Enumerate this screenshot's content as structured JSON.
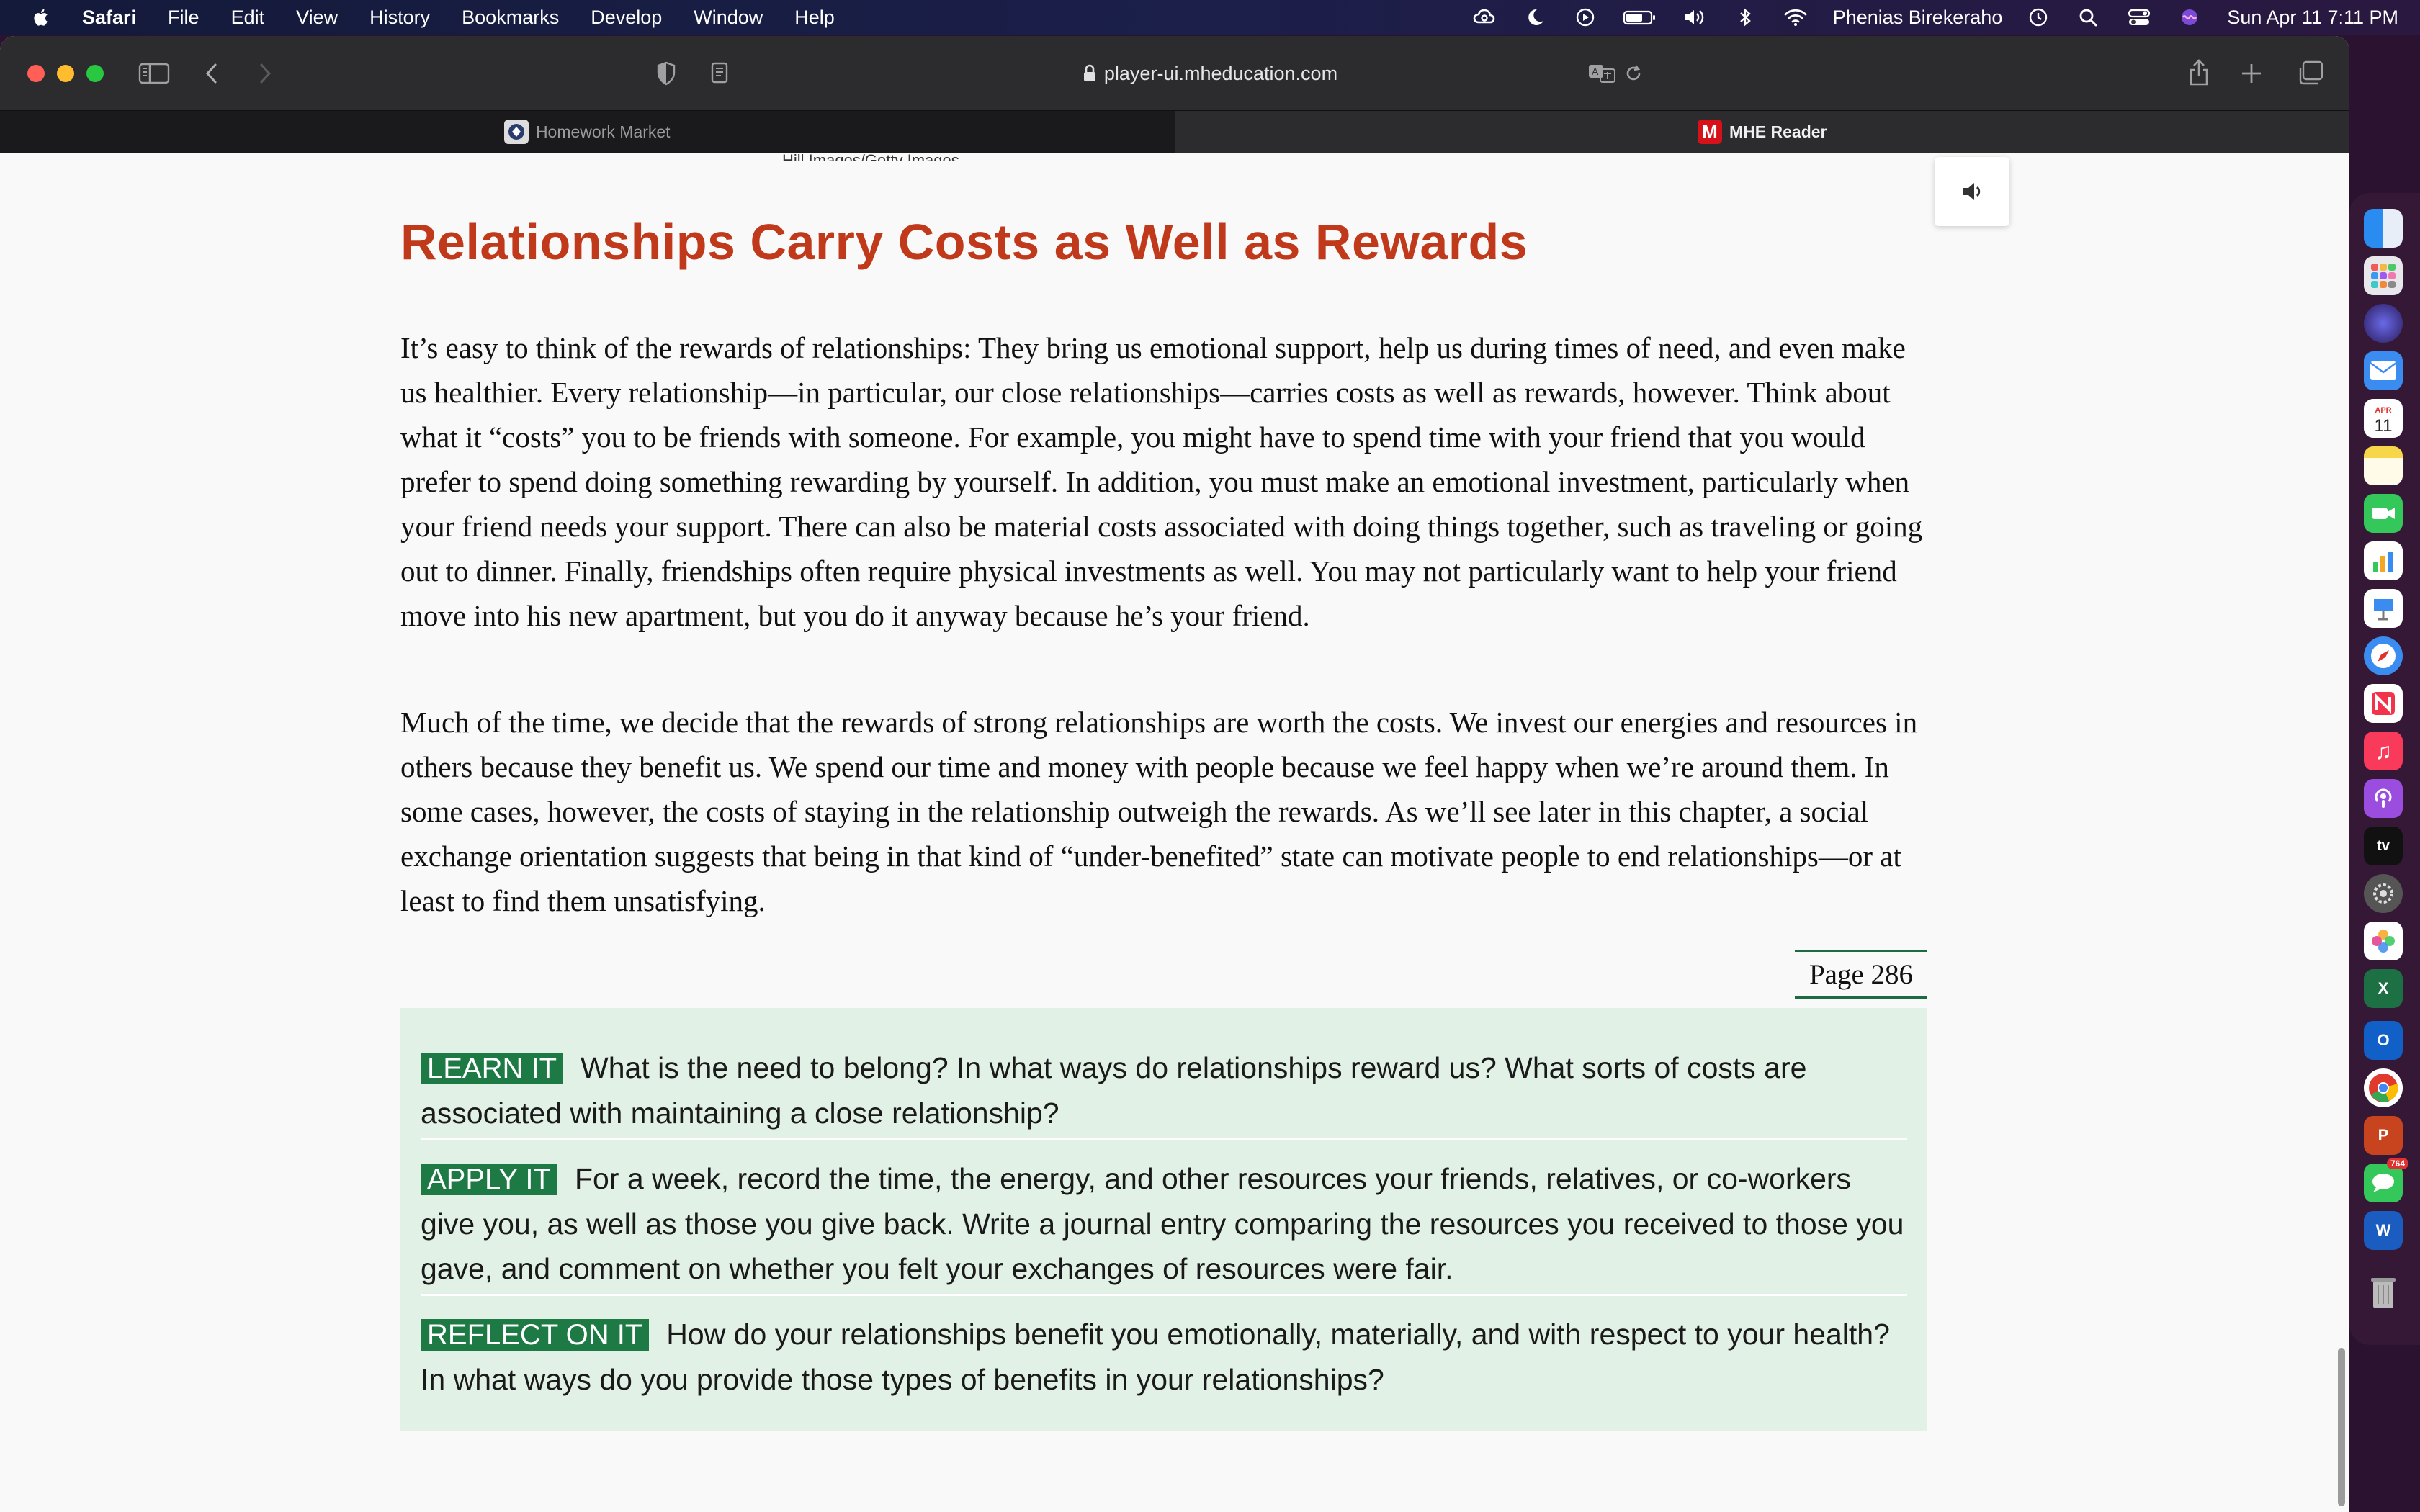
{
  "menubar": {
    "app_name": "Safari",
    "menus": [
      "File",
      "Edit",
      "View",
      "History",
      "Bookmarks",
      "Develop",
      "Window",
      "Help"
    ],
    "user_name": "Phenias Birekeraho",
    "datetime": "Sun Apr 11  7:11 PM",
    "status_icons": [
      "creative-cloud-icon",
      "moon-icon",
      "play-icon",
      "battery-icon",
      "volume-icon",
      "bluetooth-icon",
      "wifi-icon",
      "time-machine-icon",
      "spotlight-icon",
      "control-center-icon",
      "siri-icon"
    ]
  },
  "browser": {
    "url": "player-ui.mheducation.com",
    "tabs": [
      {
        "label": "Homework Market",
        "active": false
      },
      {
        "label": "MHE Reader",
        "active": true,
        "favicon_letter": "M"
      }
    ]
  },
  "page": {
    "credit": "Hill Images/Getty Images",
    "heading": "Relationships Carry Costs as Well as Rewards",
    "paragraphs": [
      "It’s easy to think of the rewards of relationships: They bring us emotional support, help us during times of need, and even make us healthier. Every relationship—in particular, our close relationships—carries costs as well as rewards, however. Think about what it “costs” you to be friends with someone. For example, you might have to spend time with your friend that you would prefer to spend doing something rewarding by yourself. In addition, you must make an emotional investment, particularly when your friend needs your support. There can also be material costs associated with doing things together, such as traveling or going out to dinner. Finally, friendships often require physical investments as well. You may not particularly want to help your friend move into his new apartment, but you do it anyway because he’s your friend.",
      "Much of the time, we decide that the rewards of strong relationships are worth the costs. We invest our energies and resources in others because they benefit us. We spend our time and money with people because we feel happy when we’re around them. In some cases, however, the costs of staying in the relationship outweigh the rewards. As we’ll see later in this chapter, a social exchange orientation suggests that being in that kind of “under-benefited” state can motivate people to end relationships—or at least to find them unsatisfying."
    ],
    "page_marker": "Page 286",
    "practice": [
      {
        "tag": "LEARN IT",
        "text": "What is the need to belong? In what ways do relationships reward us? What sorts of costs are associated with maintaining a close relationship?"
      },
      {
        "tag": "APPLY IT",
        "text": "For a week, record the time, the energy, and other resources your friends, relatives, or co-workers give you, as well as those you give back. Write a journal entry comparing the resources you received to those you gave, and comment on whether you felt your exchanges of resources were fair."
      },
      {
        "tag": "REFLECT ON IT",
        "text": "How do your relationships benefit you emotionally, materially, and with respect to your health? In what ways do you provide those types of benefits in your relationships?"
      }
    ]
  },
  "dock": {
    "calendar_day": "11",
    "calendar_month": "APR",
    "messages_badge": "764",
    "excel_letter": "X",
    "outlook_letter": "O",
    "powerpoint_letter": "P",
    "word_letter": "W",
    "tv_label": "tv"
  },
  "colors": {
    "heading": "#c0391b",
    "tag_bg": "#1e7a44",
    "practice_bg": "#e2f1e6",
    "page_rule": "#1e6b43"
  }
}
